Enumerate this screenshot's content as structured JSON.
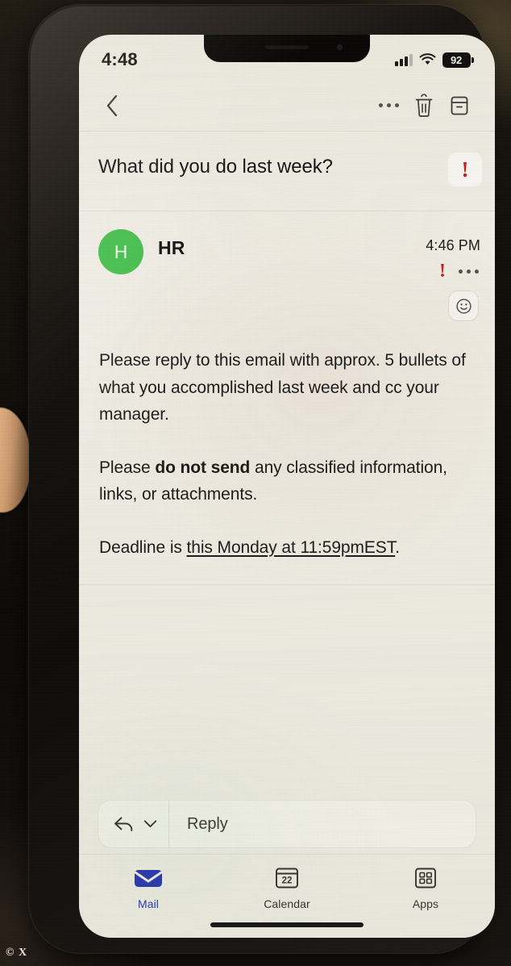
{
  "status_bar": {
    "time": "4:48",
    "battery_percent": "92",
    "signal_icon": "cellular-bars-icon",
    "wifi_icon": "wifi-icon",
    "battery_icon": "battery-icon"
  },
  "toolbar": {
    "back_icon": "chevron-left-icon",
    "more_icon": "more-horizontal-icon",
    "delete_icon": "trash-icon",
    "archive_icon": "archive-box-icon"
  },
  "subject": {
    "text": "What did you do last week?",
    "importance_icon": "exclamation-mark-icon",
    "importance_color": "#cf1d1d"
  },
  "message": {
    "avatar_initial": "H",
    "avatar_color": "#46bf4e",
    "sender": "HR",
    "time": "4:46 PM",
    "importance_icon": "exclamation-mark-icon",
    "more_icon": "more-horizontal-icon",
    "react_icon": "smiley-face-icon",
    "body": {
      "paragraph1": "Please reply to this email with approx. 5 bullets of what you accomplished last week and cc your manager.",
      "paragraph2_pre": "Please ",
      "paragraph2_bold": "do not send",
      "paragraph2_post": " any classified information, links, or attachments.",
      "paragraph3_pre": "Deadline is ",
      "paragraph3_link": "this Monday at 11:59pmEST",
      "paragraph3_post": "."
    }
  },
  "reply_bar": {
    "placeholder": "Reply",
    "reply_icon": "reply-arrow-icon",
    "chevron_icon": "chevron-down-icon"
  },
  "tab_bar": {
    "tabs": [
      {
        "label": "Mail",
        "icon": "envelope-icon",
        "active": true,
        "color": "#2c3bb0"
      },
      {
        "label": "Calendar",
        "icon": "calendar-icon",
        "active": false,
        "day": "22"
      },
      {
        "label": "Apps",
        "icon": "grid-apps-icon",
        "active": false
      }
    ]
  },
  "watermark": {
    "text": "© X"
  }
}
